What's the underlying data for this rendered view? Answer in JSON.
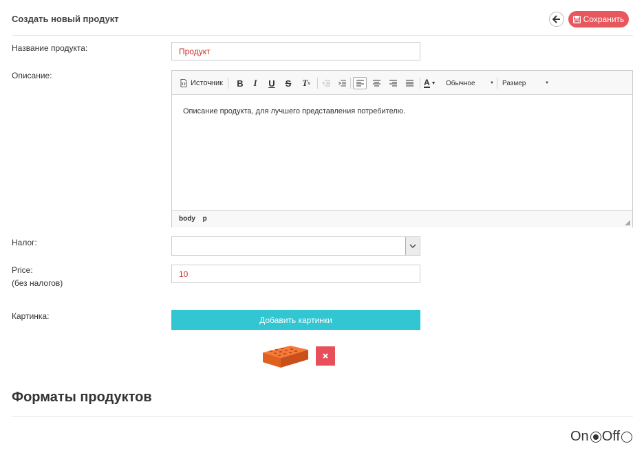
{
  "header": {
    "title": "Создать новый продукт",
    "save_label": "Сохранить"
  },
  "form": {
    "name_label": "Название продукта:",
    "name_value": "Продукт",
    "description_label": "Описание:",
    "tax_label": "Налог:",
    "tax_value": "",
    "price_label": "Price:",
    "price_sublabel": "(без налогов)",
    "price_value": "10",
    "image_label": "Картинка:",
    "add_image_label": "Добавить картинки"
  },
  "editor": {
    "source_label": "Источник",
    "format_label": "Обычное",
    "size_label": "Размер",
    "content": "Описание продукта, для лучшего представления потребителю.",
    "path": [
      "body",
      "p"
    ]
  },
  "formats": {
    "title": "Форматы продуктов",
    "on_label": "On",
    "off_label": "Off",
    "selected": "On"
  },
  "colors": {
    "save": "#e8575e",
    "add_image": "#32c5d2",
    "delete": "#e7505a",
    "input_text": "#c9302c"
  }
}
